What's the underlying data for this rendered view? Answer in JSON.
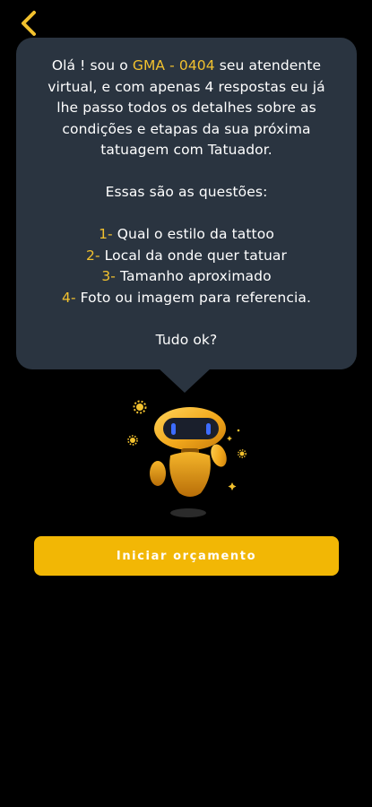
{
  "nav": {
    "back_icon": "chevron-left-icon"
  },
  "chat": {
    "intro_part1": "Olá ! sou o ",
    "bot_name": "GMA - 0404",
    "intro_part2": " seu atendente",
    "line2": "virtual, e com apenas 4 respostas eu  já",
    "line3": "lhe passo todos os detalhes sobre as",
    "line4": "condições e etapas da sua próxima",
    "line5": "tatuagem com Tatuador.",
    "questions_heading": "Essas são as questões:",
    "questions": [
      {
        "number": "1-",
        "text": " Qual o estilo da tattoo"
      },
      {
        "number": "2-",
        "text": " Local da onde quer tatuar"
      },
      {
        "number": "3-",
        "text": " Tamanho aproximado"
      },
      {
        "number": "4-",
        "text": " Foto ou imagem para referencia."
      }
    ],
    "closing": "Tudo ok?"
  },
  "mascot": {
    "icon": "robot-mascot-icon"
  },
  "actions": {
    "start_label": "Iniciar orçamento"
  },
  "colors": {
    "background": "#000000",
    "bubble": "#2a3440",
    "accent": "#f2c12e",
    "button": "#f2b705"
  }
}
